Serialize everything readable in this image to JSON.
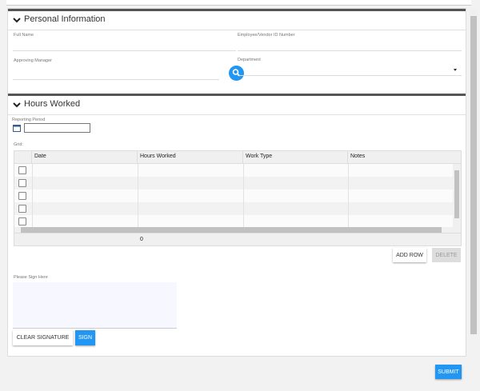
{
  "personal": {
    "title": "Personal Information",
    "full_name_label": "Full Name",
    "employee_id_label": "Employee/Vendor ID Number",
    "manager_label": "Approving Manager",
    "department_label": "Department"
  },
  "hours": {
    "title": "Hours Worked",
    "reporting_label": "Reporting Period",
    "grid_label": "Grid:",
    "columns": [
      "Date",
      "Hours Worked",
      "Work Type",
      "Notes"
    ],
    "total_hours": "0",
    "add_row": "ADD ROW",
    "delete": "DELETE"
  },
  "signature": {
    "label": "Please Sign Here",
    "clear": "CLEAR SIGNATURE",
    "sign": "SIGN"
  },
  "submit": "SUBMIT",
  "colors": {
    "accent": "#2196f3"
  }
}
